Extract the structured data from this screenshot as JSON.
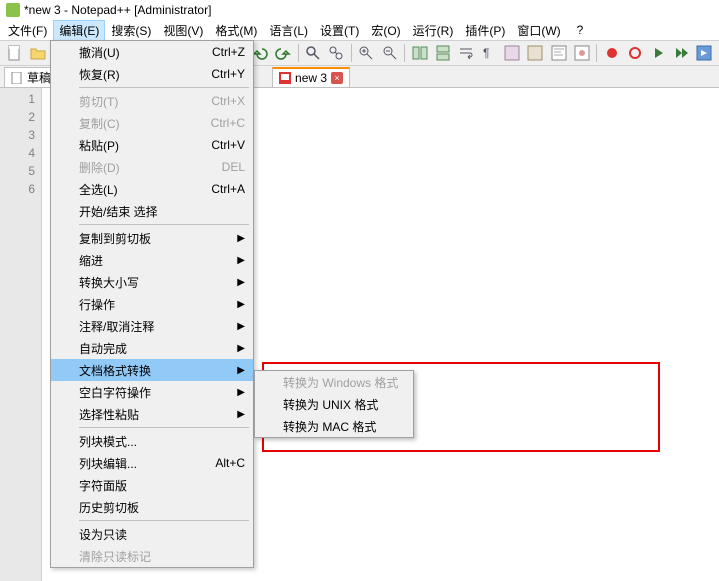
{
  "title": "*new 3 - Notepad++ [Administrator]",
  "menubar": {
    "file": "文件(F)",
    "edit": "编辑(E)",
    "search": "搜索(S)",
    "view": "视图(V)",
    "format": "格式(M)",
    "language": "语言(L)",
    "settings": "设置(T)",
    "macro": "宏(O)",
    "run": "运行(R)",
    "plugins": "插件(P)",
    "window": "窗口(W)",
    "help": "?"
  },
  "tabs": {
    "draft": "草稿纸",
    "new3": "new 3"
  },
  "gutter_lines": [
    "1",
    "2",
    "3",
    "4",
    "5",
    "6"
  ],
  "edit_menu": {
    "undo": {
      "label": "撤消(U)",
      "sc": "Ctrl+Z"
    },
    "redo": {
      "label": "恢复(R)",
      "sc": "Ctrl+Y"
    },
    "cut": {
      "label": "剪切(T)",
      "sc": "Ctrl+X"
    },
    "copy": {
      "label": "复制(C)",
      "sc": "Ctrl+C"
    },
    "paste": {
      "label": "粘贴(P)",
      "sc": "Ctrl+V"
    },
    "delete": {
      "label": "删除(D)",
      "sc": "DEL"
    },
    "select_all": {
      "label": "全选(L)",
      "sc": "Ctrl+A"
    },
    "begin_end_select": {
      "label": "开始/结束 选择"
    },
    "copy_clipboard": {
      "label": "复制到剪切板"
    },
    "indent": {
      "label": "缩进"
    },
    "convert_case": {
      "label": "转换大小写"
    },
    "line_ops": {
      "label": "行操作"
    },
    "comment": {
      "label": "注释/取消注释"
    },
    "autocomplete": {
      "label": "自动完成"
    },
    "eol_conversion": {
      "label": "文档格式转换"
    },
    "blank_ops": {
      "label": "空白字符操作"
    },
    "paste_special": {
      "label": "选择性粘贴"
    },
    "column_mode": {
      "label": "列块模式..."
    },
    "column_editor": {
      "label": "列块编辑...",
      "sc": "Alt+C"
    },
    "char_panel": {
      "label": "字符面版"
    },
    "clipboard_history": {
      "label": "历史剪切板"
    },
    "set_readonly": {
      "label": "设为只读"
    },
    "clear_readonly": {
      "label": "清除只读标记"
    }
  },
  "eol_submenu": {
    "windows": "转换为 Windows 格式",
    "unix": "转换为 UNIX 格式",
    "mac": "转换为 MAC 格式"
  }
}
